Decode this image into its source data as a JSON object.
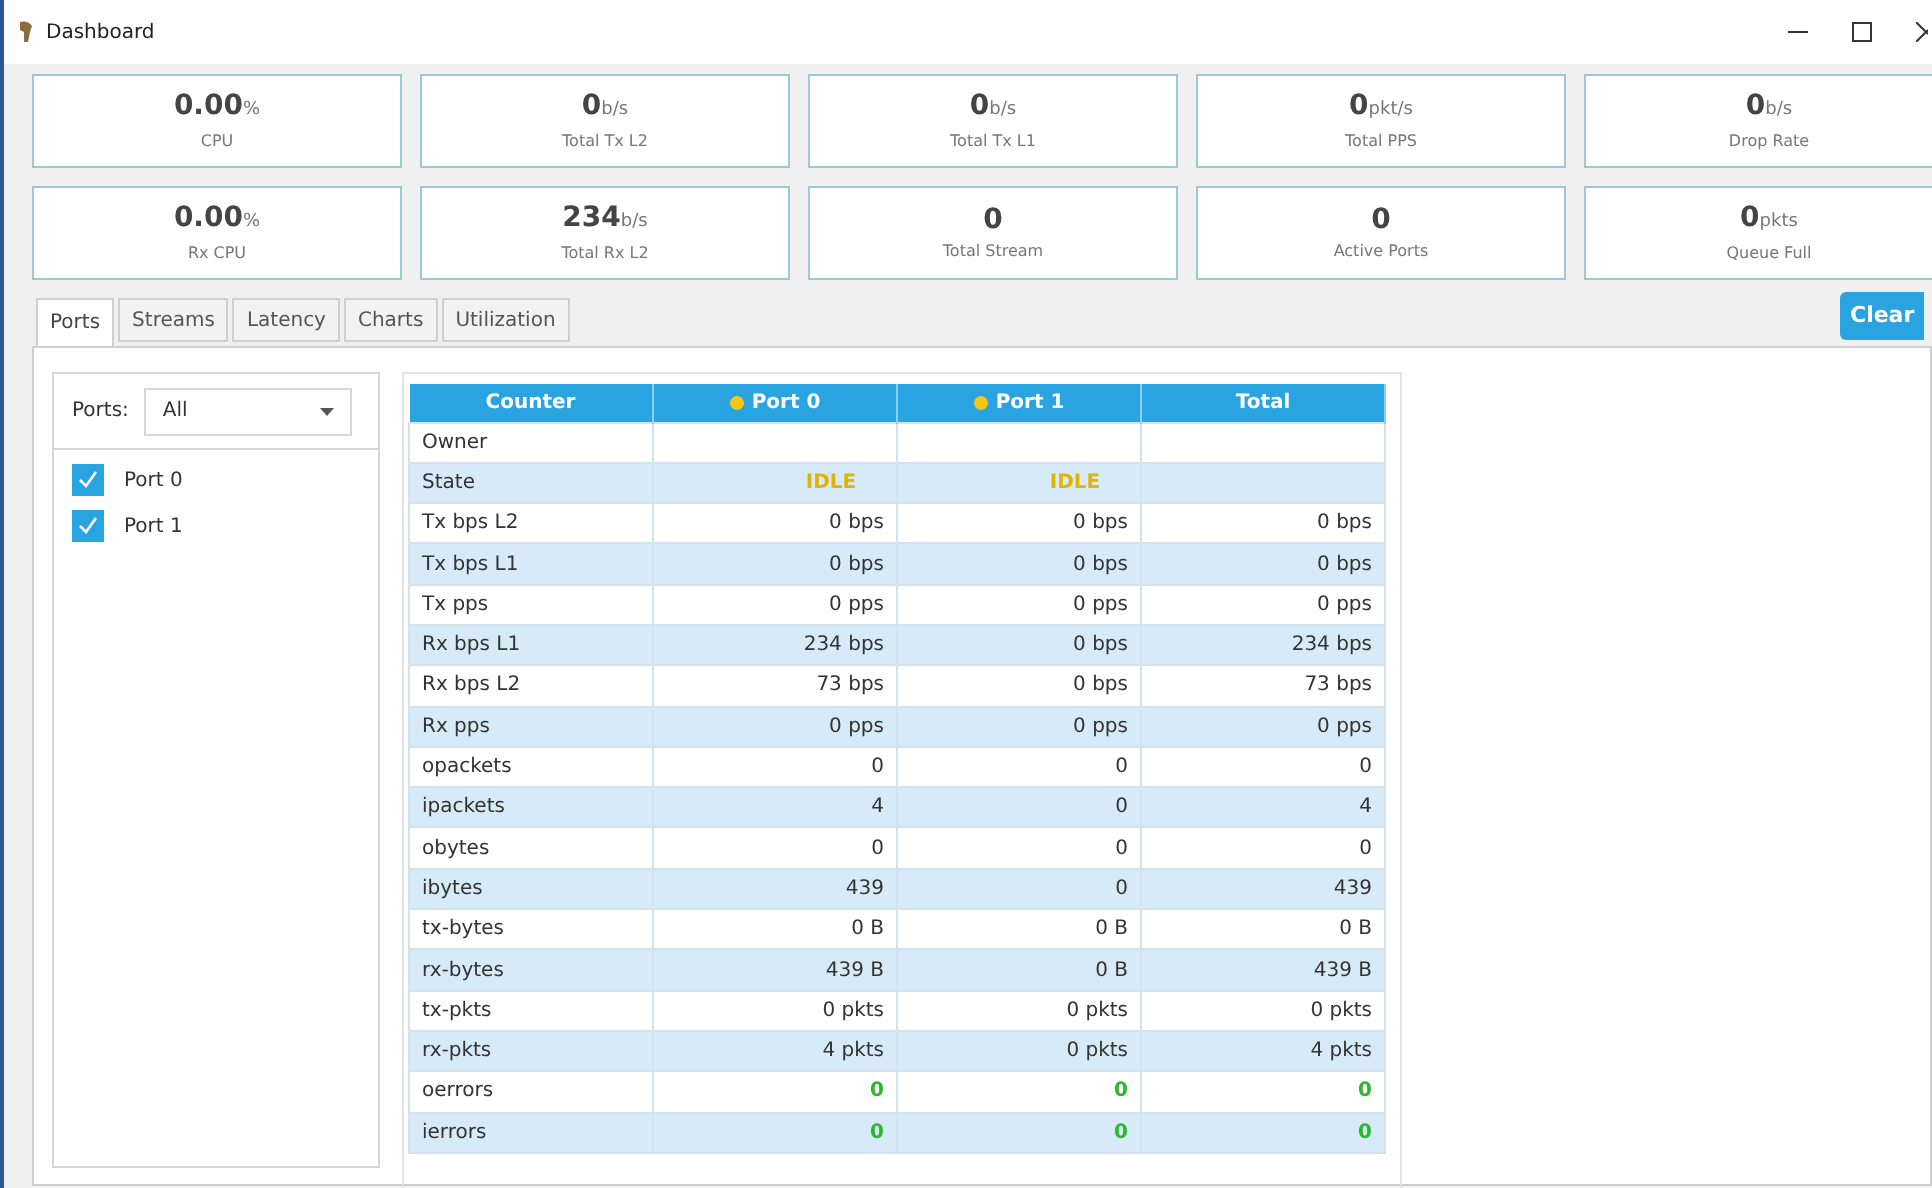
{
  "window": {
    "title": "Dashboard"
  },
  "stats": [
    {
      "value": "0.00",
      "unit": "%",
      "label": "CPU"
    },
    {
      "value": "0",
      "unit": "b/s",
      "label": "Total Tx L2"
    },
    {
      "value": "0",
      "unit": "b/s",
      "label": "Total Tx L1"
    },
    {
      "value": "0",
      "unit": "pkt/s",
      "label": "Total PPS"
    },
    {
      "value": "0",
      "unit": "b/s",
      "label": "Drop Rate"
    },
    {
      "value": "0.00",
      "unit": "%",
      "label": "Rx CPU"
    },
    {
      "value": "234",
      "unit": "b/s",
      "label": "Total Rx L2"
    },
    {
      "value": "0",
      "label": "Total Stream"
    },
    {
      "value": "0",
      "label": "Active Ports"
    },
    {
      "value": "0",
      "unit": "pkts",
      "label": "Queue Full"
    }
  ],
  "tabs": [
    {
      "label": "Ports",
      "selected": true
    },
    {
      "label": "Streams",
      "selected": false
    },
    {
      "label": "Latency",
      "selected": false
    },
    {
      "label": "Charts",
      "selected": false
    },
    {
      "label": "Utilization",
      "selected": false
    }
  ],
  "clear_button": "Clear",
  "ports_filter": {
    "label": "Ports:",
    "value": "All"
  },
  "ports": [
    {
      "label": "Port 0",
      "checked": true
    },
    {
      "label": "Port 1",
      "checked": true
    }
  ],
  "table": {
    "columns": [
      {
        "label": "Counter"
      },
      {
        "label": "Port 0",
        "color": "#f5c518"
      },
      {
        "label": "Port 1",
        "color": "#f5c518"
      },
      {
        "label": "Total"
      }
    ],
    "rows": [
      {
        "kind": "text",
        "cells": [
          "Owner",
          "",
          "",
          ""
        ]
      },
      {
        "kind": "state",
        "cells": [
          "State",
          "IDLE",
          "IDLE",
          ""
        ]
      },
      {
        "kind": "text",
        "cells": [
          "Tx bps L2",
          "0 bps",
          "0 bps",
          "0 bps"
        ]
      },
      {
        "kind": "text",
        "cells": [
          "Tx bps L1",
          "0 bps",
          "0 bps",
          "0 bps"
        ]
      },
      {
        "kind": "text",
        "cells": [
          "Tx pps",
          "0 pps",
          "0 pps",
          "0 pps"
        ]
      },
      {
        "kind": "text",
        "cells": [
          "Rx bps L1",
          "234 bps",
          "0 bps",
          "234 bps"
        ]
      },
      {
        "kind": "text",
        "cells": [
          "Rx bps L2",
          "73 bps",
          "0 bps",
          "73 bps"
        ]
      },
      {
        "kind": "text",
        "cells": [
          "Rx pps",
          "0 pps",
          "0 pps",
          "0 pps"
        ]
      },
      {
        "kind": "text",
        "cells": [
          "opackets",
          "0",
          "0",
          "0"
        ]
      },
      {
        "kind": "text",
        "cells": [
          "ipackets",
          "4",
          "0",
          "4"
        ]
      },
      {
        "kind": "text",
        "cells": [
          "obytes",
          "0",
          "0",
          "0"
        ]
      },
      {
        "kind": "text",
        "cells": [
          "ibytes",
          "439",
          "0",
          "439"
        ]
      },
      {
        "kind": "text",
        "cells": [
          "tx-bytes",
          "0 B",
          "0 B",
          "0 B"
        ]
      },
      {
        "kind": "text",
        "cells": [
          "rx-bytes",
          "439 B",
          "0 B",
          "439 B"
        ]
      },
      {
        "kind": "text",
        "cells": [
          "tx-pkts",
          "0 pkts",
          "0 pkts",
          "0 pkts"
        ]
      },
      {
        "kind": "text",
        "cells": [
          "rx-pkts",
          "4 pkts",
          "0 pkts",
          "4 pkts"
        ]
      },
      {
        "kind": "error",
        "cells": [
          "oerrors",
          "0",
          "0",
          "0"
        ]
      },
      {
        "kind": "error",
        "cells": [
          "ierrors",
          "0",
          "0",
          "0"
        ]
      }
    ]
  }
}
